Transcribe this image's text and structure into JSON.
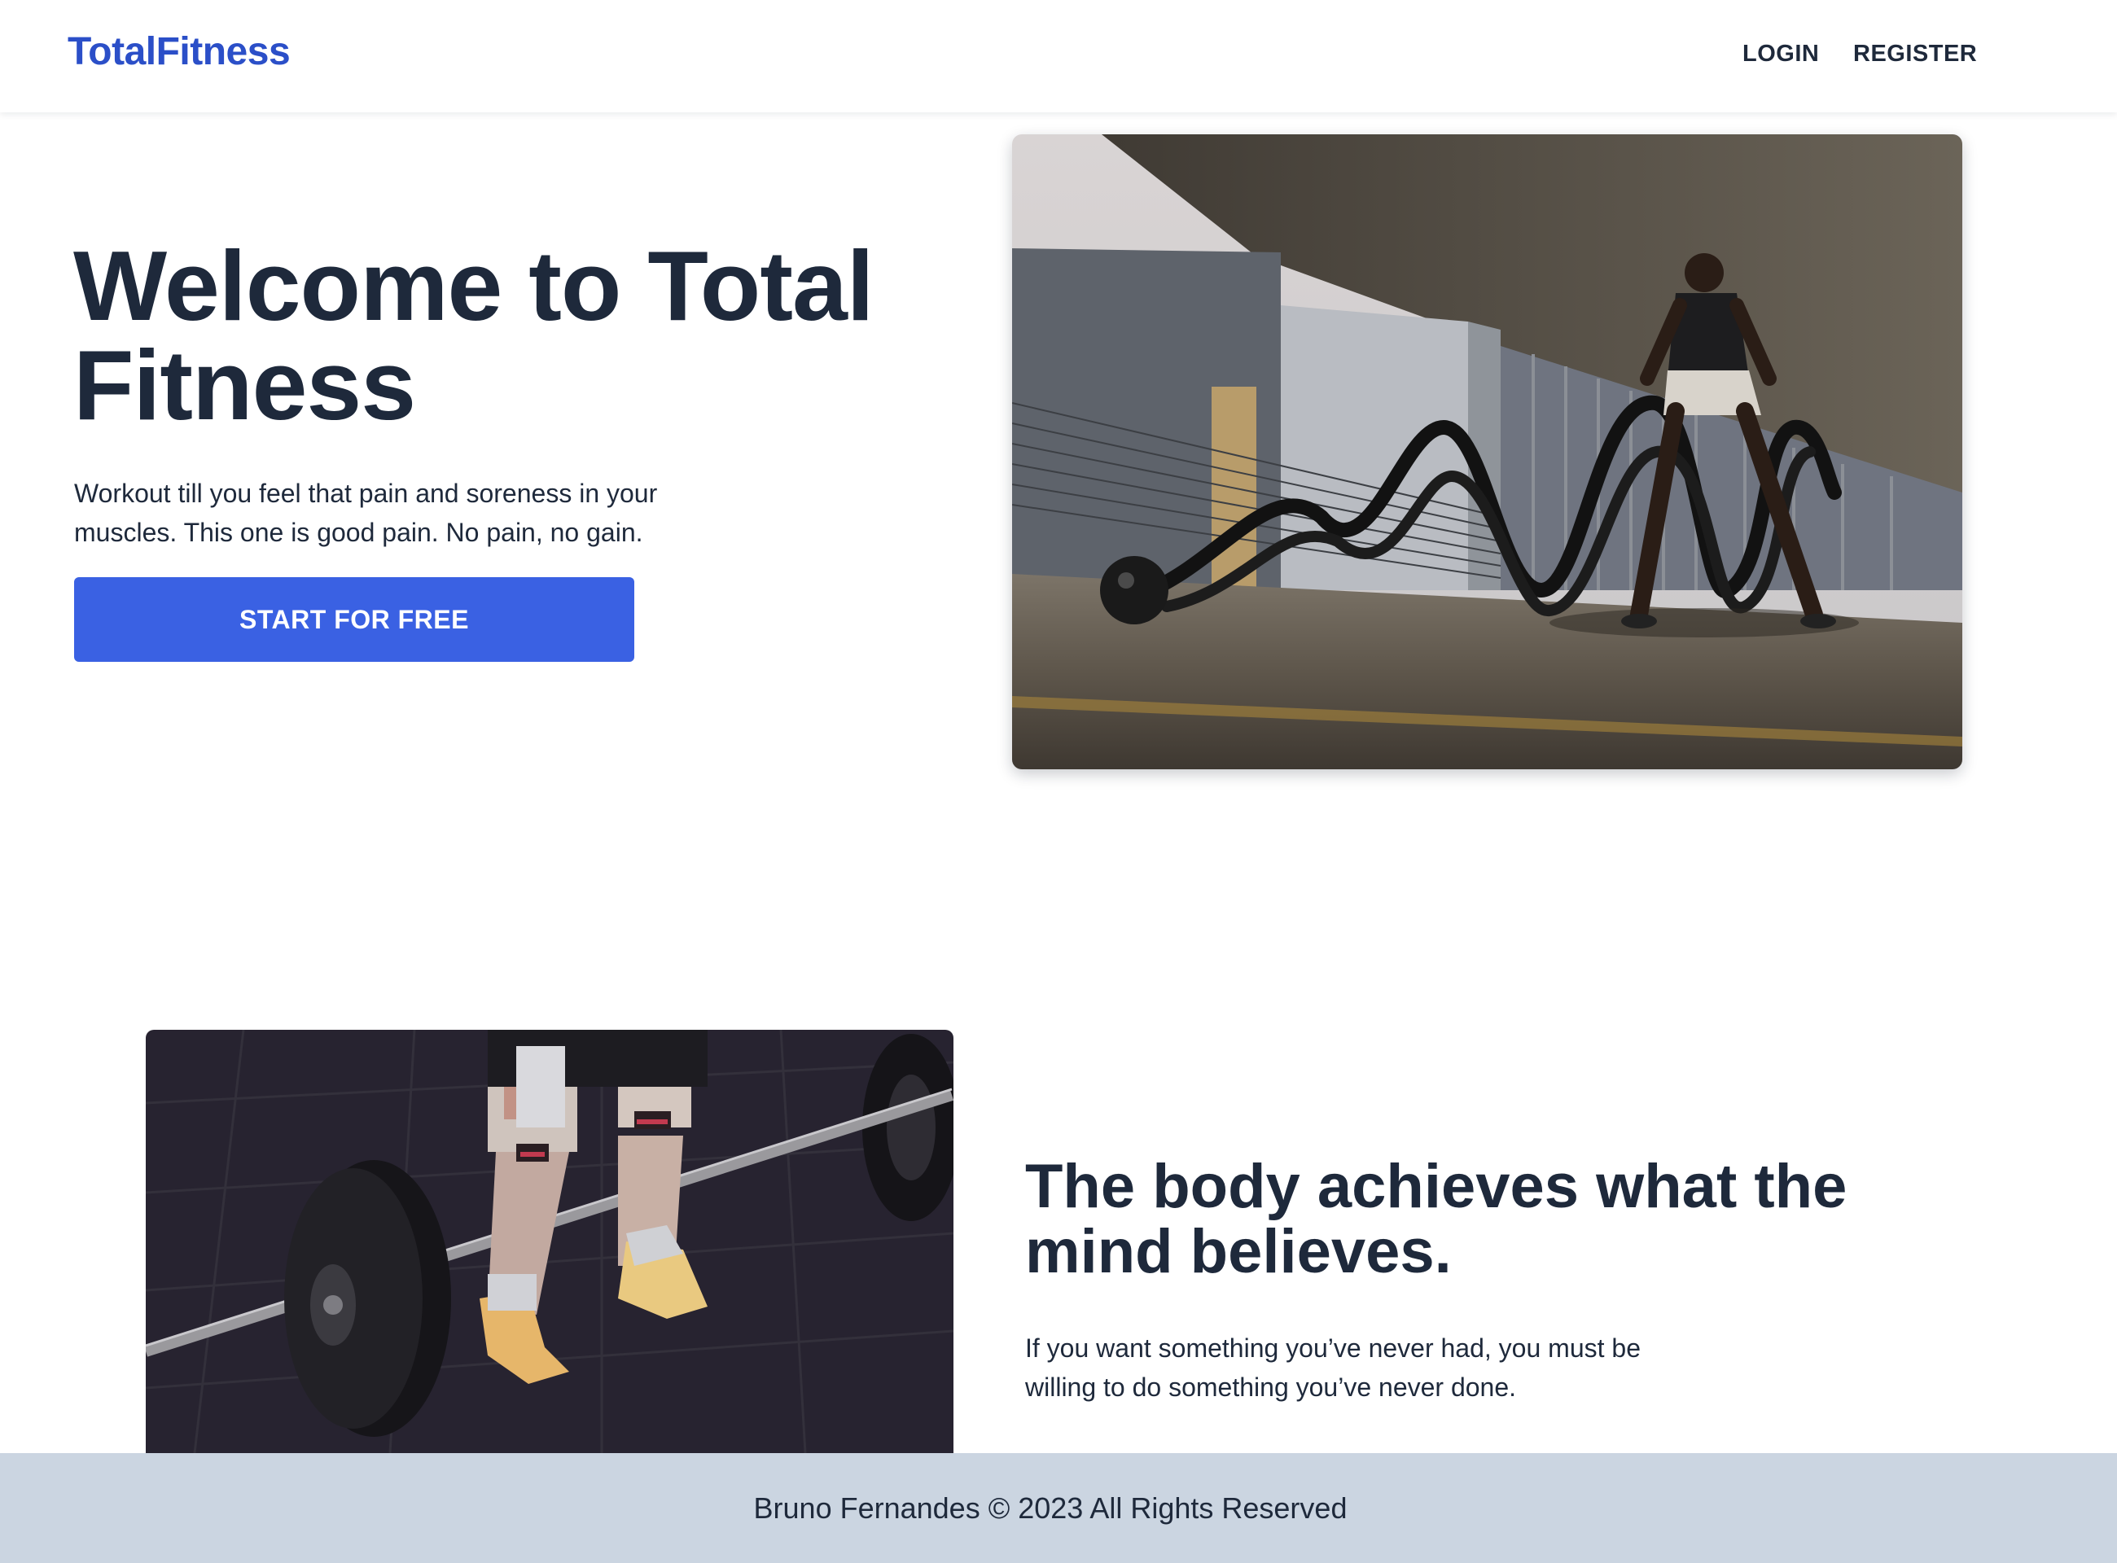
{
  "nav": {
    "logo": "TotalFitness",
    "links": [
      {
        "label": "LOGIN"
      },
      {
        "label": "REGISTER"
      }
    ]
  },
  "hero": {
    "title": "Welcome to Total Fitness",
    "text": "Workout till you feel that pain and soreness in your muscles. This one is good pain. No pain, no gain.",
    "cta_label": "START FOR FREE"
  },
  "feature": {
    "title": "The body achieves what the mind believes.",
    "text": "If you want something you’ve never had, you must be willing to do something you’ve never done."
  },
  "footer": {
    "text": "Bruno Fernandes © 2023 All Rights Reserved"
  },
  "colors": {
    "brand": "#2b4fc8",
    "button": "#3a61e3",
    "text": "#1e293b",
    "footer_bg": "#cbd5e1"
  }
}
